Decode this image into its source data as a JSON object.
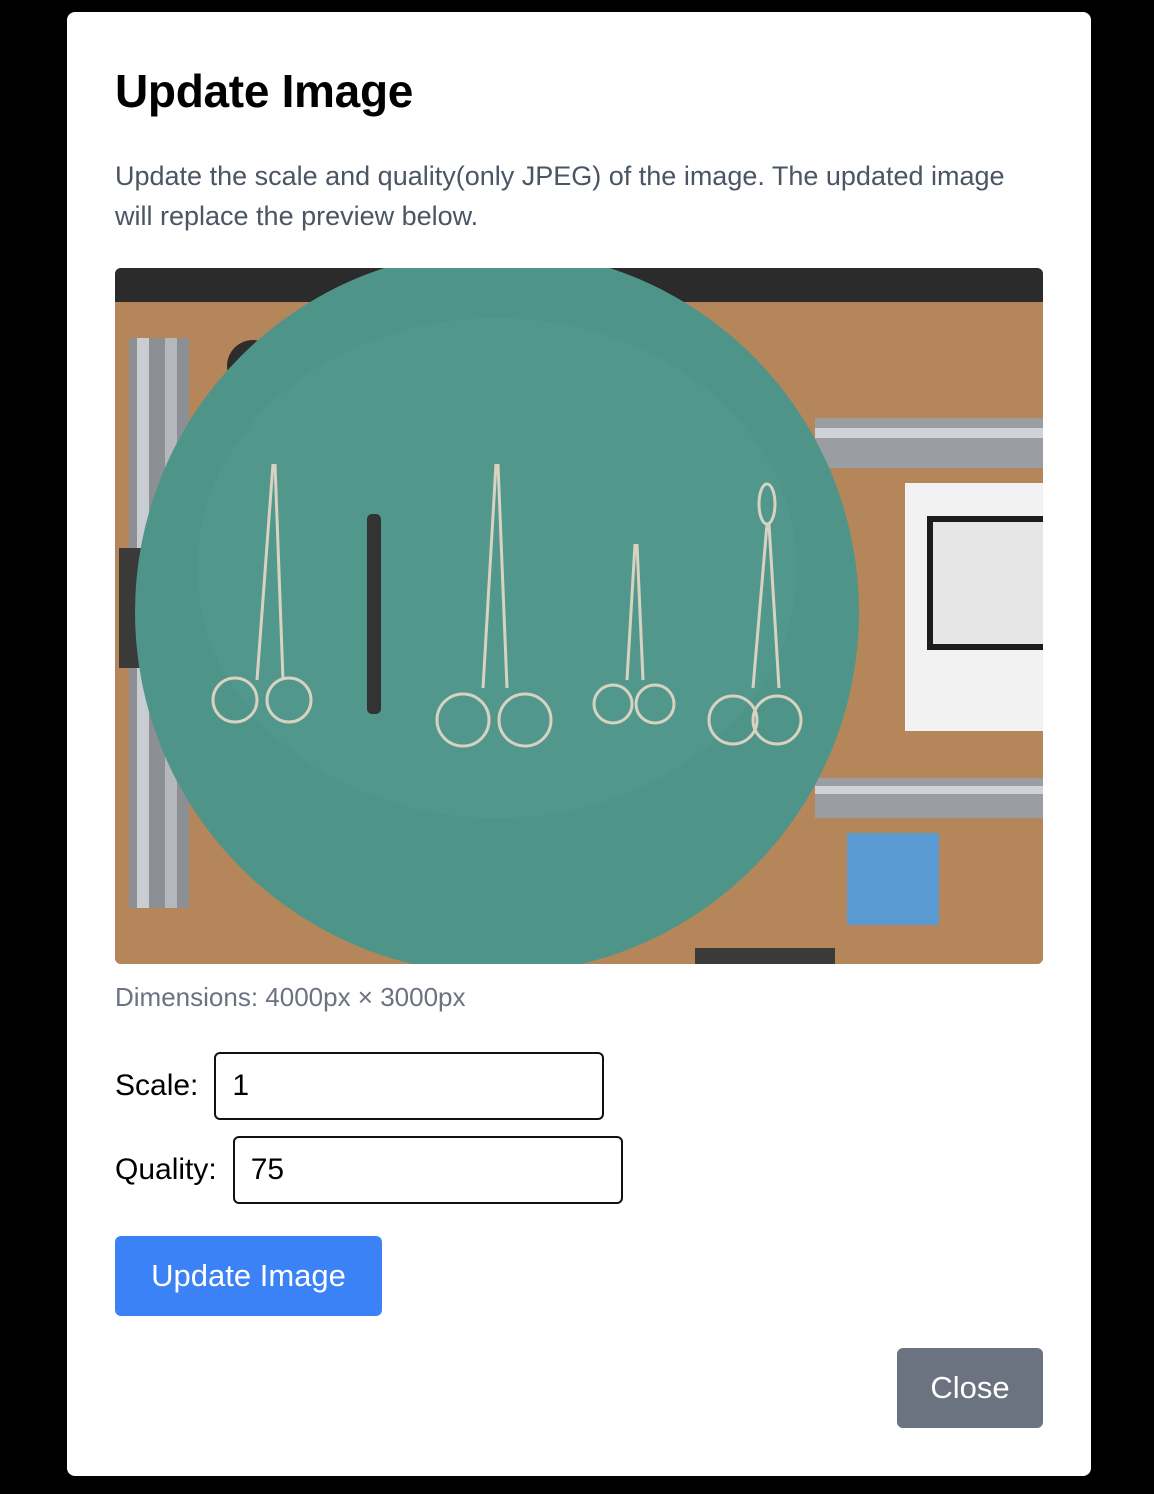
{
  "modal": {
    "title": "Update Image",
    "description": "Update the scale and quality(only JPEG) of the image. The updated image will replace the preview below.",
    "dimensions_text": "Dimensions: 4000px × 3000px",
    "preview_image": "surgical-instruments-photo",
    "scale": {
      "label": "Scale:",
      "value": "1"
    },
    "quality": {
      "label": "Quality:",
      "value": "75"
    },
    "update_button": "Update Image",
    "close_button": "Close"
  },
  "colors": {
    "primary": "#3b82f6",
    "secondary": "#6b7280",
    "backdrop": "#000000"
  }
}
